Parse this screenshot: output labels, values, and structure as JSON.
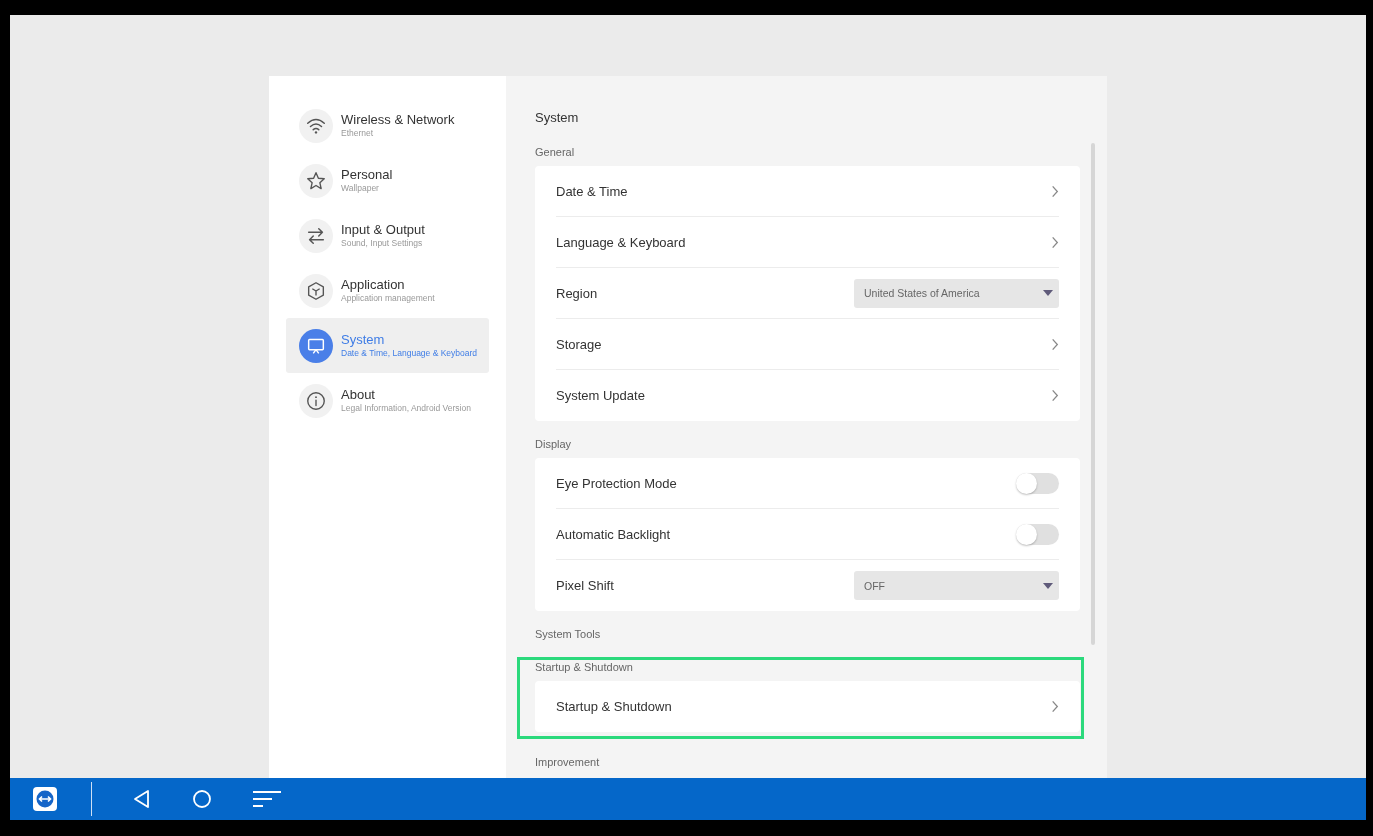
{
  "sidebar": {
    "items": [
      {
        "title": "Wireless & Network",
        "subtitle": "Ethernet",
        "selected": false
      },
      {
        "title": "Personal",
        "subtitle": "Wallpaper",
        "selected": false
      },
      {
        "title": "Input & Output",
        "subtitle": "Sound, Input Settings",
        "selected": false
      },
      {
        "title": "Application",
        "subtitle": "Application management",
        "selected": false
      },
      {
        "title": "System",
        "subtitle": "Date & Time, Language & Keyboard",
        "selected": true
      },
      {
        "title": "About",
        "subtitle": "Legal Information, Android Version",
        "selected": false
      }
    ]
  },
  "content": {
    "title": "System",
    "sections": [
      {
        "label": "General",
        "highlighted": false,
        "items": [
          {
            "kind": "link",
            "label": "Date & Time"
          },
          {
            "kind": "link",
            "label": "Language & Keyboard"
          },
          {
            "kind": "dropdown",
            "label": "Region",
            "value": "United States of America"
          },
          {
            "kind": "link",
            "label": "Storage"
          },
          {
            "kind": "link",
            "label": "System Update"
          }
        ]
      },
      {
        "label": "Display",
        "highlighted": false,
        "items": [
          {
            "kind": "toggle",
            "label": "Eye Protection Mode",
            "on": false
          },
          {
            "kind": "toggle",
            "label": "Automatic Backlight",
            "on": false
          },
          {
            "kind": "dropdown",
            "label": "Pixel Shift",
            "value": "OFF"
          }
        ]
      },
      {
        "label": "System Tools",
        "highlighted": false
      },
      {
        "label": "Startup & Shutdown",
        "highlighted": true,
        "items": [
          {
            "kind": "link",
            "label": "Startup & Shutdown"
          }
        ]
      },
      {
        "label": "Improvement",
        "highlighted": false
      }
    ]
  }
}
